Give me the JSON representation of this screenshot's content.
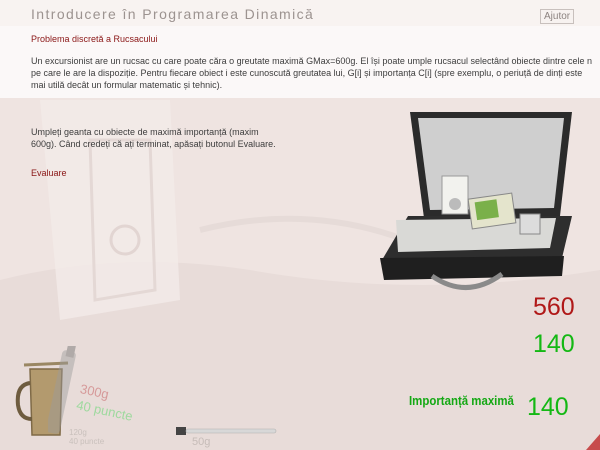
{
  "app": {
    "title": "Introducere în Programarea Dinamică",
    "help_label": "Ajutor"
  },
  "problem": {
    "title": "Problema discretă a Rucsacului",
    "description": "Un excursionist are un rucsac cu care poate căra o greutate maximă GMax=600g. El își poate umple rucsacul selectând obiecte dintre cele n pe care le are la dispoziție. Pentru fiecare obiect i este cunoscută greutatea lui, G[i] și importanța C[i] (spre exemplu, o periuță de dinți este mai utilă decât un formular matematic și tehnic)."
  },
  "instructions": {
    "text": "Umpleți geanta cu obiecte de maximă importanță (maxim 600g). Când credeți că ați terminat, apăsați butonul Evaluare.",
    "evaluate_label": "Evaluare"
  },
  "totals": {
    "current_weight": "560",
    "current_importance": "140",
    "max_importance_label": "Importanță maximă",
    "max_importance_value": "140"
  },
  "items": {
    "mug_weight": "120g",
    "mug_points": "40 puncte",
    "bottle_weight": "300g",
    "bottle_points": "40 puncte",
    "toothbrush_weight": "50g"
  },
  "colors": {
    "weight": "#b01818",
    "importance": "#14b814",
    "accent": "#8a1616"
  },
  "icons": [
    "bag-icon",
    "mug-icon",
    "bottle-icon",
    "toothbrush-icon",
    "device-icon"
  ]
}
